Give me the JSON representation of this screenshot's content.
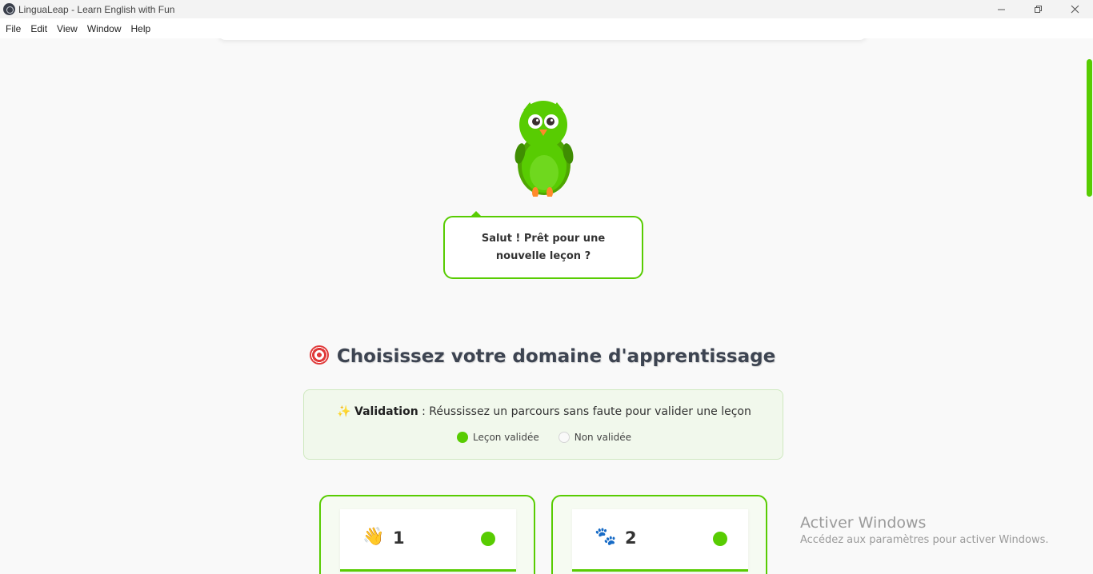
{
  "window": {
    "title": "LinguaLeap - Learn English with Fun",
    "controls": [
      "minimize-icon",
      "restore-icon",
      "close-icon"
    ]
  },
  "menubar": {
    "items": [
      "File",
      "Edit",
      "View",
      "Window",
      "Help"
    ]
  },
  "mascot": {
    "icon": "owl-mascot-icon",
    "speech": "Salut ! Prêt pour une nouvelle leçon ?"
  },
  "section": {
    "icon": "target-icon",
    "title": "Choisissez votre domaine d'apprentissage"
  },
  "validation": {
    "icon": "sparkles-icon",
    "label": "Validation",
    "text": ": Réussissez un parcours sans faute pour valider une leçon",
    "legend": {
      "validated": "Leçon validée",
      "not_validated": "Non validée"
    }
  },
  "cards": [
    {
      "emoji": "👋",
      "number": "1",
      "status": "validated"
    },
    {
      "emoji": "🐾",
      "number": "2",
      "status": "validated"
    }
  ],
  "watermark": {
    "title": "Activer Windows",
    "subtitle": "Accédez aux paramètres pour activer Windows."
  },
  "colors": {
    "accent": "#58cc02",
    "validation_bg": "#f1f8ec",
    "text": "#333333"
  }
}
